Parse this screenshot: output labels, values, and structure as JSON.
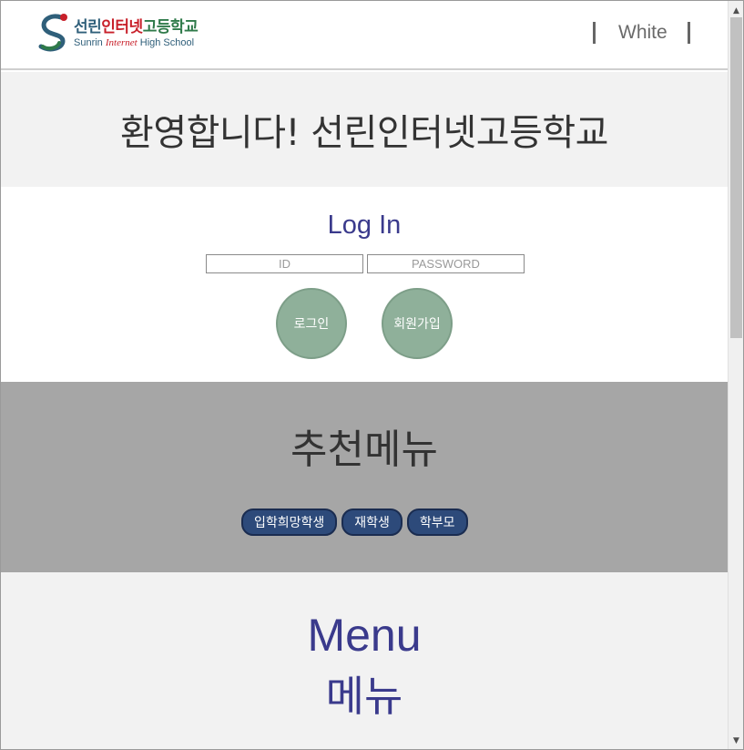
{
  "header": {
    "logo": {
      "korean_parts": [
        "선린",
        "인터넷",
        "고등학교"
      ],
      "english_parts": [
        "Sunrin ",
        "Internet",
        " High School"
      ]
    },
    "theme_link": "White"
  },
  "welcome": {
    "title": "환영합니다! 선린인터넷고등학교"
  },
  "login": {
    "title": "Log In",
    "id_placeholder": "ID",
    "password_placeholder": "PASSWORD",
    "login_button": "로그인",
    "signup_button": "회원가입"
  },
  "recommend": {
    "title": "추천메뉴",
    "buttons": [
      "입학희망학생",
      "재학생",
      "학부모"
    ]
  },
  "menu": {
    "title": "Menu",
    "subtitle": "메뉴"
  },
  "colors": {
    "accent_text": "#3a3a8c",
    "circle_button": "#8fb09a",
    "pill_button": "#2d4a7a",
    "recommend_bg": "#a6a6a6",
    "section_bg": "#f2f2f2"
  },
  "icons": {
    "logo": "sunrin-logo-icon",
    "scroll_up": "scroll-up-arrow-icon",
    "scroll_down": "scroll-down-arrow-icon"
  }
}
